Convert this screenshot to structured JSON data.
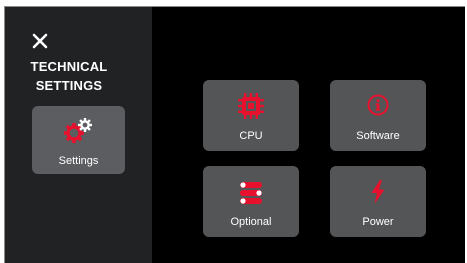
{
  "sidebar": {
    "close_icon": "close-icon",
    "title": "TECHNICAL\nSETTINGS",
    "settings_button": {
      "label": "Settings",
      "icon": "gear-icon"
    }
  },
  "tiles": [
    {
      "label": "CPU",
      "icon": "cpu-chip-icon"
    },
    {
      "label": "Software",
      "icon": "info-icon"
    },
    {
      "label": "Optional",
      "icon": "list-toggle-icon"
    },
    {
      "label": "Power",
      "icon": "lightning-bolt-icon"
    }
  ],
  "colors": {
    "accent": "#e8112d",
    "background": "#000000",
    "sidebar": "#202224",
    "tile": "#545557",
    "text": "#ffffff"
  }
}
